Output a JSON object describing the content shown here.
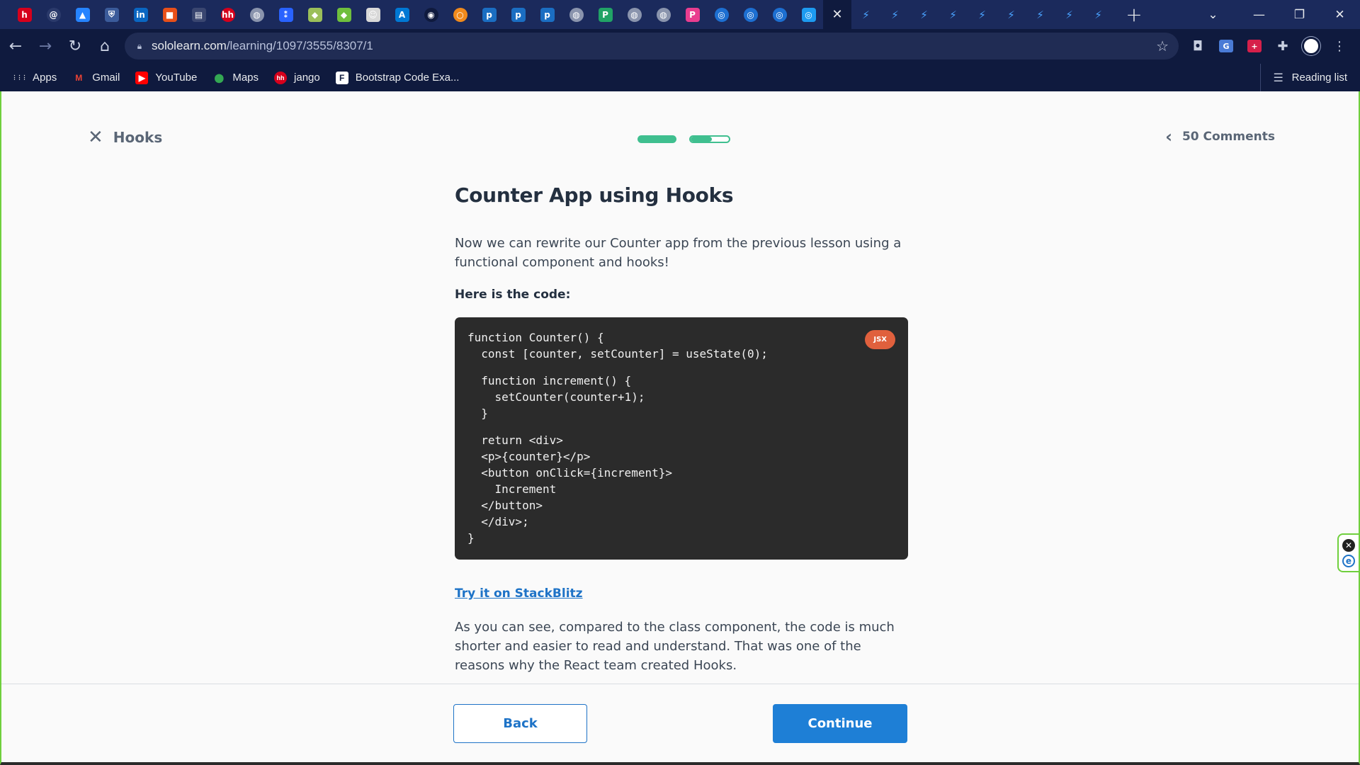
{
  "browser": {
    "tabs": [
      {
        "name": "tab-hh",
        "glyph": "h",
        "bg": "#d6001c",
        "round": false
      },
      {
        "name": "tab-at",
        "glyph": "@",
        "bg": "#2b3a6b",
        "round": true
      },
      {
        "name": "tab-atlassian",
        "glyph": "▲",
        "bg": "#2684ff",
        "round": false
      },
      {
        "name": "tab-shield",
        "glyph": "⛨",
        "bg": "#3b5b9a",
        "round": false
      },
      {
        "name": "tab-linkedin",
        "glyph": "in",
        "bg": "#0a66c2",
        "round": false
      },
      {
        "name": "tab-office",
        "glyph": "■",
        "bg": "#e8501a",
        "round": false
      },
      {
        "name": "tab-book",
        "glyph": "▤",
        "bg": "#3a4670",
        "round": false
      },
      {
        "name": "tab-hh-2",
        "glyph": "hh",
        "bg": "#d6001c",
        "round": true
      },
      {
        "name": "tab-globe-1",
        "glyph": "◍",
        "bg": "#8a94ad",
        "round": true
      },
      {
        "name": "tab-bolt-blue",
        "glyph": "⁑",
        "bg": "#2962ff",
        "round": false
      },
      {
        "name": "tab-android-1",
        "glyph": "◆",
        "bg": "#9bbf5a",
        "round": false
      },
      {
        "name": "tab-android-2",
        "glyph": "◆",
        "bg": "#6fbf3d",
        "round": false
      },
      {
        "name": "tab-avatar",
        "glyph": "☺",
        "bg": "#d8d8d8",
        "round": false
      },
      {
        "name": "tab-azure",
        "glyph": "A",
        "bg": "#0078d4",
        "round": false
      },
      {
        "name": "tab-github",
        "glyph": "◉",
        "bg": "#0f1a3e",
        "round": true
      },
      {
        "name": "tab-ring",
        "glyph": "○",
        "bg": "#f08a1c",
        "round": true
      },
      {
        "name": "tab-p-1",
        "glyph": "p",
        "bg": "#1b6ec2",
        "round": false
      },
      {
        "name": "tab-p-2",
        "glyph": "p",
        "bg": "#1b6ec2",
        "round": false
      },
      {
        "name": "tab-p-3",
        "glyph": "p",
        "bg": "#1b6ec2",
        "round": false
      },
      {
        "name": "tab-globe-2",
        "glyph": "◍",
        "bg": "#8a94ad",
        "round": true
      },
      {
        "name": "tab-p-green",
        "glyph": "P",
        "bg": "#21a366",
        "round": false
      },
      {
        "name": "tab-globe-3",
        "glyph": "◍",
        "bg": "#8a94ad",
        "round": true
      },
      {
        "name": "tab-globe-4",
        "glyph": "◍",
        "bg": "#8a94ad",
        "round": true
      },
      {
        "name": "tab-p-pink",
        "glyph": "P",
        "bg": "#e93d8f",
        "round": false
      },
      {
        "name": "tab-ring-blue-1",
        "glyph": "◎",
        "bg": "#1d6fd1",
        "round": true
      },
      {
        "name": "tab-ring-blue-2",
        "glyph": "◎",
        "bg": "#1d6fd1",
        "round": true
      },
      {
        "name": "tab-ring-blue-3",
        "glyph": "◎",
        "bg": "#1d6fd1",
        "round": true
      },
      {
        "name": "tab-ring-blue-4",
        "glyph": "◎",
        "bg": "#1d9bf0",
        "round": false
      }
    ],
    "active_tab_close": "✕",
    "bolt_tabs": [
      "⚡",
      "⚡",
      "⚡",
      "⚡",
      "⚡",
      "⚡",
      "⚡",
      "⚡",
      "⚡"
    ],
    "new_tab": "+",
    "tab_search": "⌄",
    "window": {
      "minimize": "—",
      "restore": "❐",
      "close": "✕"
    },
    "url_host": "sololearn.com",
    "url_path": "/learning/1097/3555/8307/1",
    "bookmarks": [
      {
        "label": "Apps",
        "icon": "⋮⋮⋮",
        "color": "#e8eaed",
        "bg": "transparent"
      },
      {
        "label": "Gmail",
        "icon": "M",
        "color": "#ea4335",
        "bg": "transparent"
      },
      {
        "label": "YouTube",
        "icon": "▶",
        "color": "#ffffff",
        "bg": "#ff0000"
      },
      {
        "label": "Maps",
        "icon": "⬤",
        "color": "#34a853",
        "bg": "transparent"
      },
      {
        "label": "jango",
        "icon": "hh",
        "color": "#ffffff",
        "bg": "#d6001c"
      },
      {
        "label": "Bootstrap Code Exa...",
        "icon": "F",
        "color": "#0f1a3e",
        "bg": "#ffffff"
      }
    ],
    "reading_list": "Reading list"
  },
  "lesson": {
    "close_label": "Hooks",
    "comments_label": "50 Comments",
    "progress": [
      1.0,
      0.55
    ],
    "title": "Counter App using Hooks",
    "intro": "Now we can rewrite our Counter app from the previous lesson using a functional component and hooks!",
    "code_intro": "Here is the code:",
    "code_language": "JSX",
    "code_lines": [
      "function Counter() {",
      "  const [counter, setCounter] = useState(0);",
      "",
      "  function increment() {",
      "    setCounter(counter+1);",
      "  }",
      "",
      "  return <div>",
      "  <p>{counter}</p>",
      "  <button onClick={increment}>",
      "    Increment",
      "  </button>",
      "  </div>;",
      "}"
    ],
    "try_link": "Try it on StackBlitz",
    "outro": "As you can see, compared to the class component, the code is much shorter and easier to read and understand. That was one of the reasons why the React team created Hooks.",
    "back_label": "Back",
    "continue_label": "Continue"
  },
  "colors": {
    "accent_blue": "#1e7fd6",
    "progress_green": "#3fbf8f",
    "badge_orange": "#e0603d",
    "code_bg": "#2b2b2b"
  }
}
